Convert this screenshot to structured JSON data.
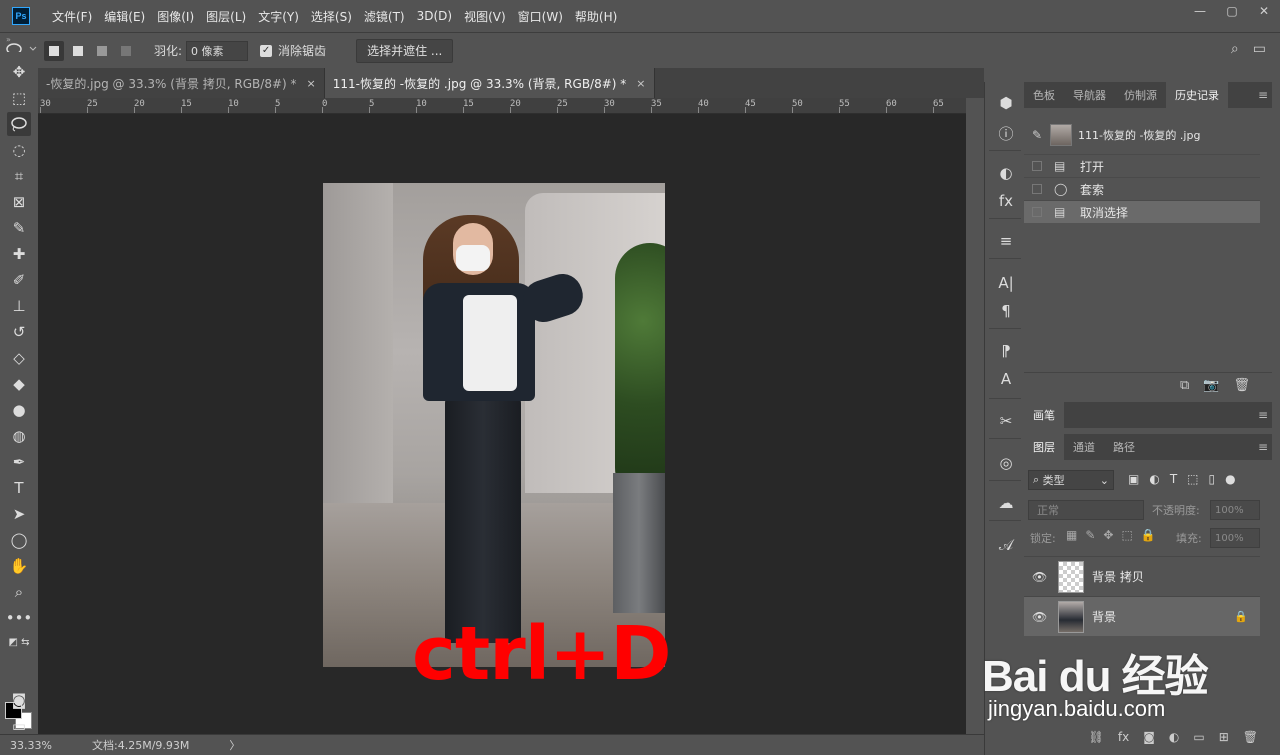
{
  "menubar": {
    "logo": "Ps",
    "items": [
      "文件(F)",
      "编辑(E)",
      "图像(I)",
      "图层(L)",
      "文字(Y)",
      "选择(S)",
      "滤镜(T)",
      "3D(D)",
      "视图(V)",
      "窗口(W)",
      "帮助(H)"
    ],
    "window_controls": [
      "—",
      "▢",
      "✕"
    ]
  },
  "options": {
    "feather_label": "羽化:",
    "feather_value": "0 像素",
    "antialias_label": "消除锯齿",
    "select_mask_button": "选择并遮住 ..."
  },
  "tabs": [
    {
      "label": "-恢复的.jpg @ 33.3% (背景 拷贝, RGB/8#) *",
      "close": "×",
      "active": false
    },
    {
      "label": "111-恢复的 -恢复的 .jpg @ 33.3% (背景, RGB/8#) *",
      "close": "×",
      "active": true
    }
  ],
  "ruler": {
    "labels": [
      "30",
      "25",
      "20",
      "15",
      "10",
      "5",
      "0",
      "5",
      "10",
      "15",
      "20",
      "25",
      "30",
      "35",
      "40",
      "45",
      "50",
      "55",
      "60",
      "65"
    ]
  },
  "canvas": {
    "overlay_text": "ctrl+D"
  },
  "status": {
    "zoom": "33.33%",
    "doc_info": "文档:4.25M/9.93M",
    "arrow": "〉"
  },
  "history_panel": {
    "tabs": [
      "色板",
      "导航器",
      "仿制源",
      "历史记录"
    ],
    "active_tab": "历史记录",
    "snapshot_label": "111-恢复的 -恢复的 .jpg",
    "steps": [
      {
        "label": "打开",
        "icon": "document-icon",
        "selected": false
      },
      {
        "label": "套索",
        "icon": "lasso-icon",
        "selected": false
      },
      {
        "label": "取消选择",
        "icon": "document-icon",
        "selected": true
      }
    ]
  },
  "brush_panel": {
    "tab": "画笔"
  },
  "layers_panel": {
    "tabs": [
      "图层",
      "通道",
      "路径"
    ],
    "active_tab": "图层",
    "filter_label": "类型",
    "blend_mode": "正常",
    "opacity_label": "不透明度:",
    "opacity_value": "100%",
    "lock_label": "锁定:",
    "fill_label": "填充:",
    "fill_value": "100%",
    "layers": [
      {
        "name": "背景 拷贝",
        "selected": false,
        "locked": false
      },
      {
        "name": "背景",
        "selected": true,
        "locked": true
      }
    ]
  },
  "watermark": {
    "logo": "Bai du 经验",
    "url": "jingyan.baidu.com"
  },
  "colors": {
    "panel_bg": "#535353",
    "canvas_bg": "#282828",
    "overlay_red": "#ff0000",
    "foreground": "#000000",
    "background": "#ffffff"
  }
}
